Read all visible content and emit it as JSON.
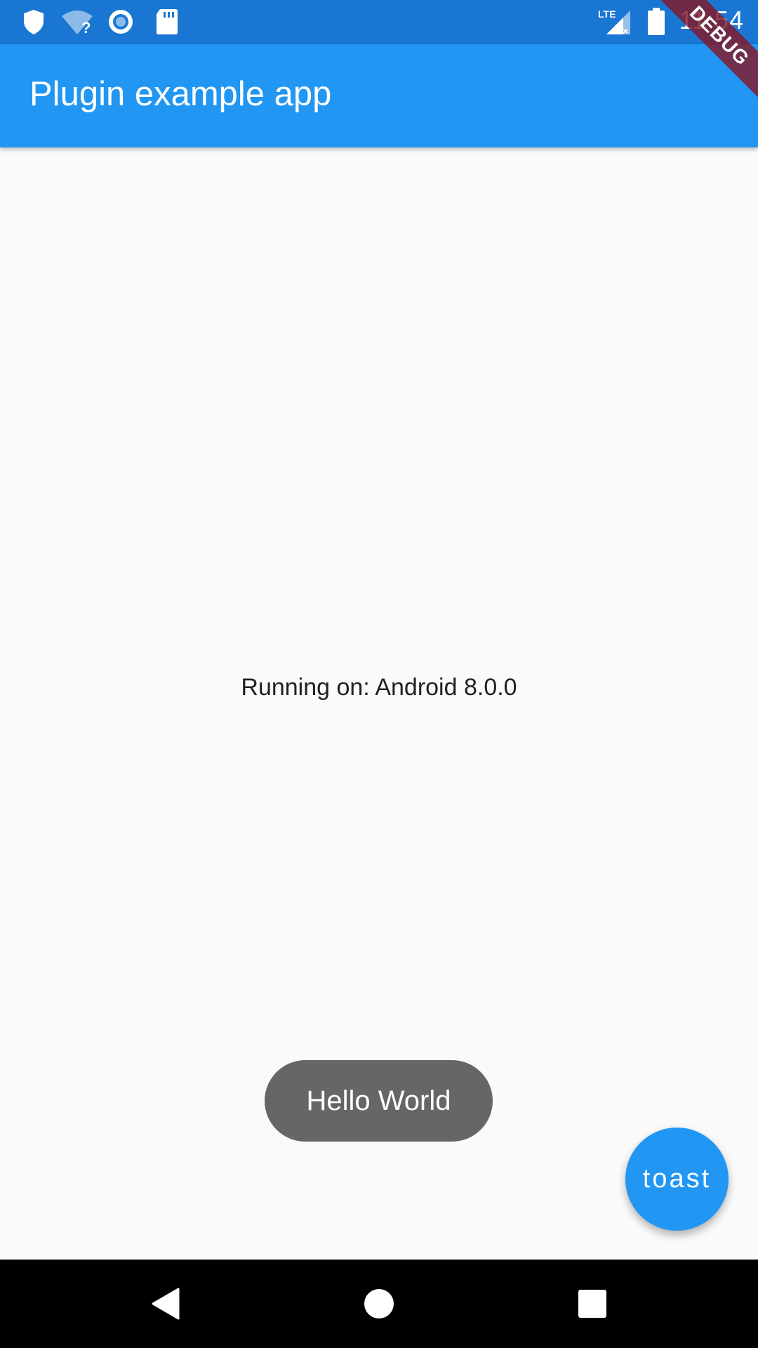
{
  "status_bar": {
    "time": "11:54",
    "network": "LTE",
    "icons": [
      "shield-icon",
      "wifi-unknown-icon",
      "record-icon",
      "sd-card-icon",
      "lte-signal-icon",
      "battery-icon"
    ]
  },
  "debug_banner": "DEBUG",
  "app_bar": {
    "title": "Plugin example app"
  },
  "main": {
    "platform_text": "Running on: Android 8.0.0"
  },
  "toast": {
    "message": "Hello World"
  },
  "fab": {
    "label": "toast"
  },
  "nav_bar": {
    "icons": [
      "back-icon",
      "home-icon",
      "recents-icon"
    ]
  },
  "colors": {
    "status_bar": "#1976d2",
    "app_bar": "#2196f3",
    "background": "#fafafa",
    "toast": "#666666",
    "fab": "#2196f3",
    "debug_banner": "#821828"
  }
}
